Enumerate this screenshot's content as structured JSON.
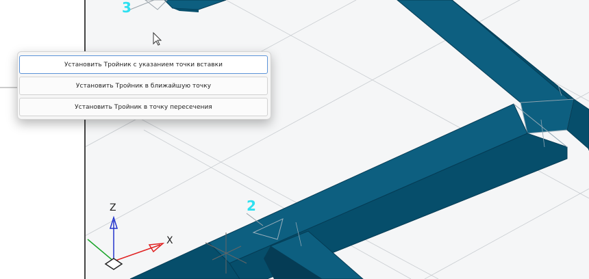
{
  "context_menu": {
    "items": [
      {
        "label": "Установить Тройник с указанием точки вставки",
        "active": true
      },
      {
        "label": "Установить Тройник в ближайшую точку",
        "active": false
      },
      {
        "label": "Установить Тройник в точку пересечения",
        "active": false
      }
    ]
  },
  "viewport": {
    "point_labels": [
      "3",
      "2"
    ],
    "axis_labels": {
      "x": "X",
      "z": "Z"
    },
    "colors": {
      "duct_top": "#0d5f80",
      "duct_side": "#064e6b",
      "duct_dark": "#053c55",
      "label": "#2ee0f0",
      "axis_x": "#e02020",
      "axis_y": "#1aa52a",
      "axis_z": "#2233cc",
      "background": "#f5f6f7"
    }
  }
}
